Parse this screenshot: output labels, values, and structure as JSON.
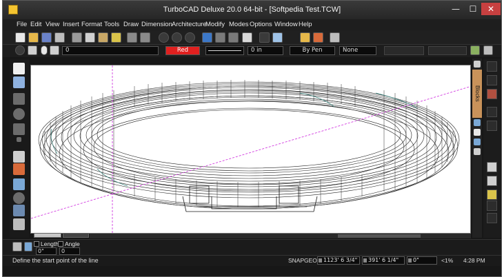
{
  "window": {
    "title": "TurboCAD Deluxe 20.0 64-bit - [Softpedia Test.TCW]"
  },
  "window_controls": {
    "minimize": "—",
    "maximize": "☐",
    "close": "✕"
  },
  "menu": [
    "File",
    "Edit",
    "View",
    "Insert",
    "Format",
    "Tools",
    "Draw",
    "Dimension",
    "Architecture",
    "Modify",
    "Modes",
    "Options",
    "Window",
    "Help"
  ],
  "properties": {
    "layer": "0",
    "color": "Red",
    "line_width": "0 in",
    "pen": "By Pen",
    "fill": "None"
  },
  "right_panel": {
    "blocks_label": "Blocks"
  },
  "inspector": {
    "length_label": "Length",
    "angle_label": "Angle",
    "length_value": "0\"",
    "angle_value": "0"
  },
  "status": {
    "message": "Define the start point of the line",
    "snap": "SNAP",
    "geo": "GEO",
    "x_coord": "1123' 6 3/4\"",
    "y_coord": "391' 6 1/4\"",
    "z_coord": "0\"",
    "zoom": "<1%",
    "time": "4:28 PM"
  },
  "colors": {
    "accent_red": "#e0201f",
    "guide_magenta": "#d23be0",
    "wire_teal": "#2f7f78",
    "blocks_tab": "#c9925a"
  },
  "icons": {
    "toolbar": [
      "new-file-icon",
      "open-icon",
      "save-icon",
      "print-icon",
      "cut-icon",
      "copy-icon",
      "paste-icon",
      "undo-icon",
      "redo-icon",
      "zoom-window-icon",
      "zoom-out-icon",
      "zoom-all-icon",
      "render-icon",
      "layer-icon",
      "spell-icon",
      "selector-icon",
      "library-icon",
      "design-director-icon",
      "pan-icon"
    ],
    "left_tools": [
      "select-arrow-icon",
      "select-point-icon",
      "line-icon",
      "circle-icon",
      "arc-icon",
      "point-icon",
      "text-icon",
      "hatch-icon",
      "snap-icon",
      "measure-icon",
      "modify-icon",
      "grid-icon"
    ]
  }
}
